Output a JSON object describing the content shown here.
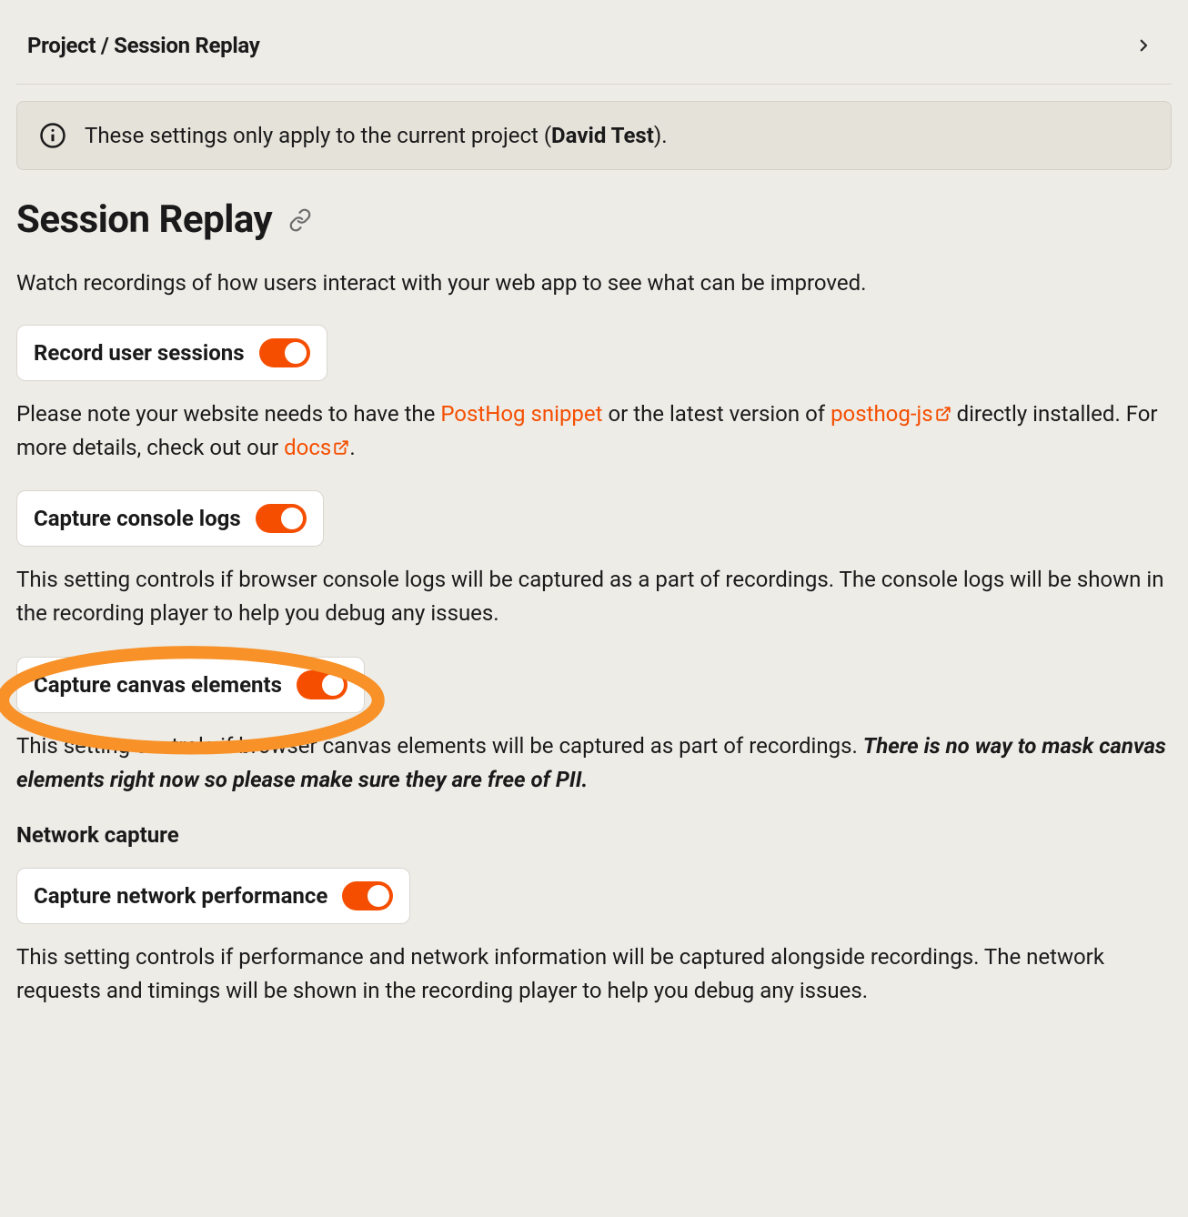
{
  "breadcrumb": "Project / Session Replay",
  "info_banner": {
    "prefix": "These settings only apply to the current project (",
    "project_name": "David Test",
    "suffix": ")."
  },
  "heading": "Session Replay",
  "intro": "Watch recordings of how users interact with your web app to see what can be improved.",
  "toggles": {
    "record_sessions": {
      "label": "Record user sessions",
      "on": true
    },
    "capture_console": {
      "label": "Capture console logs",
      "on": true
    },
    "capture_canvas": {
      "label": "Capture canvas elements",
      "on": true
    },
    "capture_network": {
      "label": "Capture network performance",
      "on": true
    }
  },
  "record_desc": {
    "p1": "Please note your website needs to have the ",
    "link1": "PostHog snippet",
    "p2": " or the latest version of ",
    "link2": "posthog-js",
    "p3": " directly installed. For more details, check out our ",
    "link3": "docs",
    "p4": "."
  },
  "console_desc": "This setting controls if browser console logs will be captured as a part of recordings. The console logs will be shown in the recording player to help you debug any issues.",
  "canvas_desc": {
    "p1": "This setting controls if browser canvas elements will be captured as part of recordings. ",
    "warn": "There is no way to mask canvas elements right now so please make sure they are free of PII."
  },
  "network_heading": "Network capture",
  "network_desc": "This setting controls if performance and network information will be captured alongside recordings. The network requests and timings will be shown in the recording player to help you debug any issues."
}
